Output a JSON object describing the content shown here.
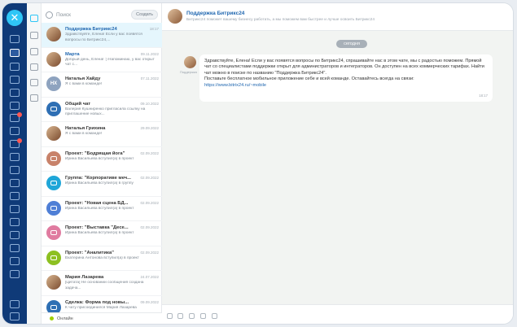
{
  "search": {
    "placeholder": "Поиск",
    "create_label": "Создать"
  },
  "chats": [
    {
      "name": "Поддержка Битрикс24",
      "date": "18:17",
      "preview": "Здравствуйте, Елена! Если у вас появятся вопросы по Битрикс24,...",
      "avatar": "photo",
      "selected": true,
      "bx": true
    },
    {
      "name": "Марта",
      "date": "09.11.2022",
      "preview": "Добрый день, Елена! :) Напоминаю, у вас открыт чат с...",
      "avatar": "photo",
      "bx": true
    },
    {
      "name": "Наталья Хайду",
      "date": "07.11.2022",
      "preview": "Я с вами в команде!",
      "avatar": "initials",
      "initials": "НХ",
      "color": "#8ea3bf"
    },
    {
      "name": "Общий чат",
      "date": "09.10.2022",
      "preview": "Валерия Кушниренко пригласила ссылку на приглашение новых...",
      "avatar": "chat",
      "color": "#2e6fb4"
    },
    {
      "name": "Наталья Грихина",
      "date": "29.09.2022",
      "preview": "Я с вами в команде!",
      "avatar": "photo"
    },
    {
      "name": "Проект: \"Бодрящая йога\"",
      "date": "02.09.2022",
      "preview": "Ирина Васильева вступил(а) в проект",
      "avatar": "group",
      "color": "#c8826a"
    },
    {
      "name": "Группа: \"Корпоративе меч...",
      "date": "02.09.2022",
      "preview": "Ирина Васильева вступил(а) в группу",
      "avatar": "group",
      "color": "#1fa6d8"
    },
    {
      "name": "Проект: \"Новая сцена БД...",
      "date": "02.09.2022",
      "preview": "Ирина Васильева вступил(а) в проект",
      "avatar": "group",
      "color": "#4f7fd6"
    },
    {
      "name": "Проект: \"Выставка \"Десе...",
      "date": "02.09.2022",
      "preview": "Ирина Васильева вступил(а) в проект",
      "avatar": "group",
      "color": "#e07ba0"
    },
    {
      "name": "Проект: \"Аналитика\"",
      "date": "02.09.2022",
      "preview": "Екатерина Антонова вступил(а) в проект",
      "avatar": "group",
      "color": "#8dc021"
    },
    {
      "name": "Мария Лазарева",
      "date": "24.07.2022",
      "preview": "[Цитата] Не основании сообщения создана задача...",
      "avatar": "photo"
    },
    {
      "name": "Сделка: Форма под новы...",
      "date": "09.09.2022",
      "preview": "К чату присоединился Мария Лазарева",
      "avatar": "deal",
      "color": "#2e6fb4"
    }
  ],
  "status": {
    "label": "Онлайн"
  },
  "header": {
    "title": "Поддержка Битрикс24",
    "subtitle": "Битрикс24 поможет вашему бизнесу работать, а мы поможем вам быстрее и лучше освоить Битрикс24"
  },
  "conversation": {
    "date_pill": "сегодня",
    "avatar_label": "Поддержка",
    "message": "Здравствуйте, Елена! Если у вас появятся вопросы по Битрикс24, спрашивайте нас в этом чате, мы с радостью поможем. Прямой чат со специалистами поддержки открыт для администраторов и интеграторов. Он доступен на всех коммерческих тарифах. Найти чат можно в поиске по названию \"Поддержка Битрикс24\".",
    "message_line2": "Поставьте бесплатное мобильное приложение себе и всей команде. Оставайтесь всегда на связи:",
    "link": "https://www.bitrix24.ru/~mobile",
    "time": "18:17"
  },
  "colors": {
    "rail": "#0f3a78",
    "accent": "#2fc6f6",
    "link": "#2067b0",
    "selected": "#e5f6fd"
  }
}
